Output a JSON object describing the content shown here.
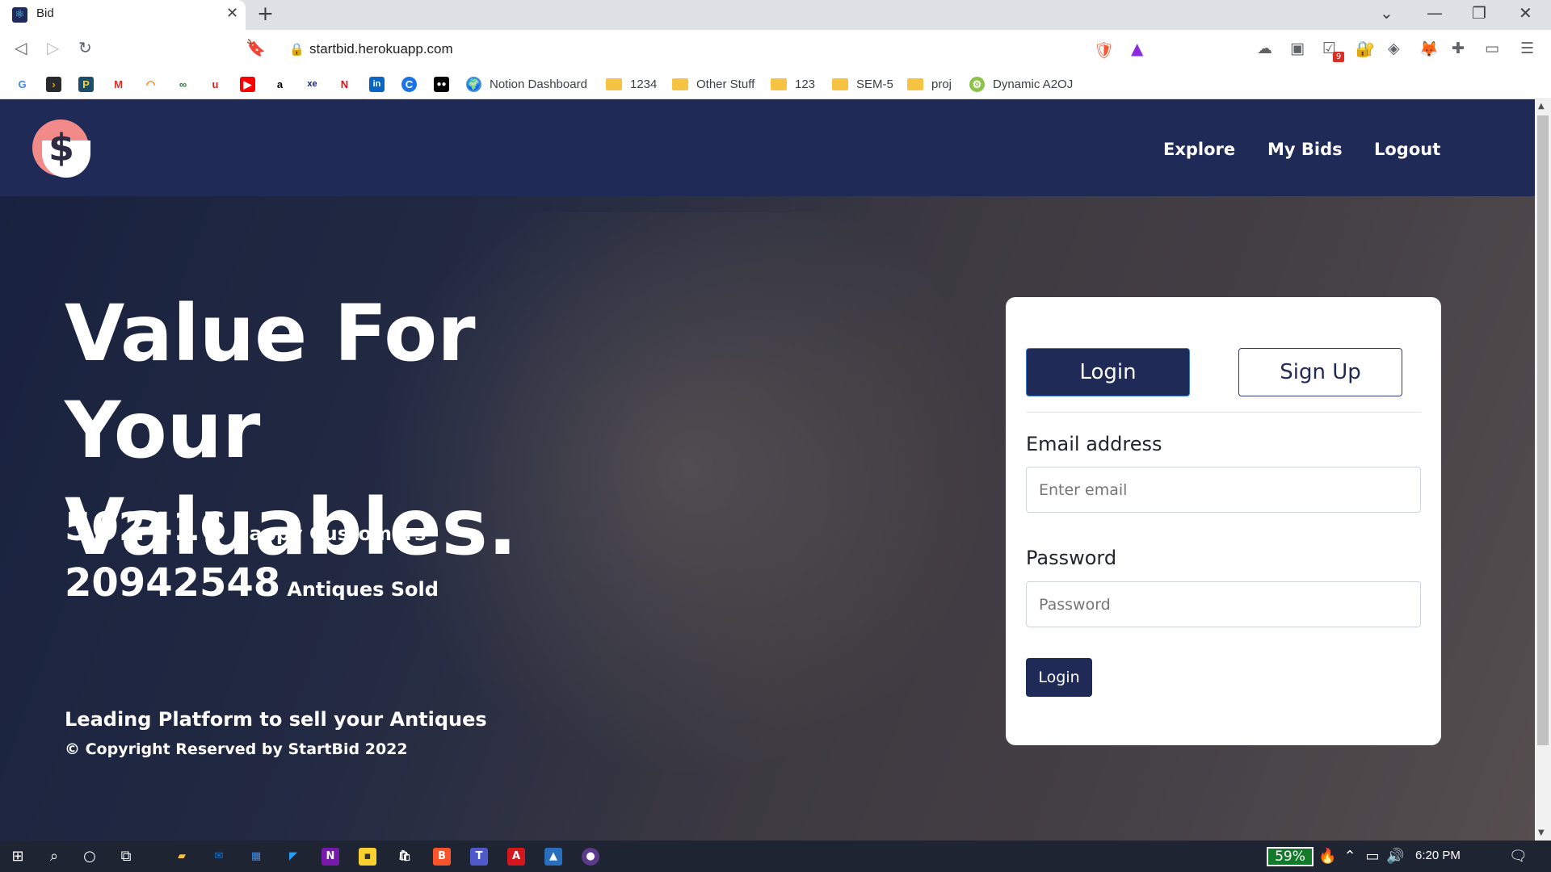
{
  "browser": {
    "tab_title": "Bid",
    "url": "startbid.herokuapp.com",
    "bookmarks": [
      {
        "label": "Notion Dashboard",
        "type": "site"
      },
      {
        "label": "1234",
        "type": "folder"
      },
      {
        "label": "Other Stuff",
        "type": "folder"
      },
      {
        "label": "123",
        "type": "folder"
      },
      {
        "label": "SEM-5",
        "type": "folder"
      },
      {
        "label": "proj",
        "type": "folder"
      },
      {
        "label": "Dynamic A2OJ",
        "type": "site"
      }
    ],
    "extension_badge": "9"
  },
  "nav": {
    "links": [
      "Explore",
      "My Bids",
      "Logout"
    ]
  },
  "hero": {
    "headline": "Value For Your Valuables.",
    "stats": [
      {
        "value": "502416",
        "label": "Happy Customers"
      },
      {
        "value": "20942548",
        "label": "Antiques Sold"
      }
    ],
    "tagline": "Leading Platform to sell your Antiques",
    "copyright": "© Copyright Reserved by StartBid 2022"
  },
  "auth": {
    "tab_login": "Login",
    "tab_signup": "Sign Up",
    "email_label": "Email address",
    "email_placeholder": "Enter email",
    "password_label": "Password",
    "password_placeholder": "Password",
    "submit": "Login"
  },
  "taskbar": {
    "battery": "59%",
    "time": "6:20 PM"
  },
  "colors": {
    "brand_navy": "#202a56",
    "logo_pink": "#f38a8a"
  }
}
